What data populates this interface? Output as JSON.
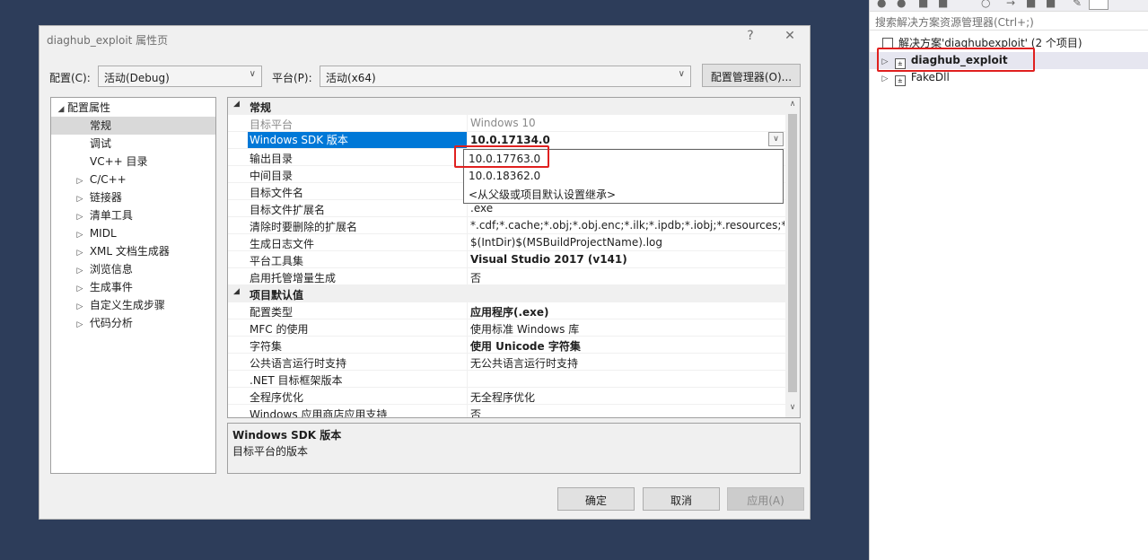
{
  "dialog": {
    "title": "diaghub_exploit 属性页",
    "help": "?",
    "close": "✕",
    "config_label": "配置(C):",
    "config_value": "活动(Debug)",
    "platform_label": "平台(P):",
    "platform_value": "活动(x64)",
    "config_manager": "配置管理器(O)...",
    "ok": "确定",
    "cancel": "取消",
    "apply": "应用(A)"
  },
  "tree": {
    "root": "配置属性",
    "items": [
      {
        "label": "常规",
        "expandable": false,
        "selected": true
      },
      {
        "label": "调试",
        "expandable": false
      },
      {
        "label": "VC++ 目录",
        "expandable": false
      },
      {
        "label": "C/C++",
        "expandable": true
      },
      {
        "label": "链接器",
        "expandable": true
      },
      {
        "label": "清单工具",
        "expandable": true
      },
      {
        "label": "MIDL",
        "expandable": true
      },
      {
        "label": "XML 文档生成器",
        "expandable": true
      },
      {
        "label": "浏览信息",
        "expandable": true
      },
      {
        "label": "生成事件",
        "expandable": true
      },
      {
        "label": "自定义生成步骤",
        "expandable": true
      },
      {
        "label": "代码分析",
        "expandable": true
      }
    ]
  },
  "grid": {
    "cat_general": "常规",
    "cat_defaults": "项目默认值",
    "general_rows": [
      {
        "name": "目标平台",
        "value": "Windows 10",
        "style": "gray"
      },
      {
        "name": "Windows SDK 版本",
        "value": "10.0.17134.0",
        "style": "selected"
      },
      {
        "name": "输出目录",
        "value": ""
      },
      {
        "name": "中间目录",
        "value": ""
      },
      {
        "name": "目标文件名",
        "value": ""
      },
      {
        "name": "目标文件扩展名",
        "value": ".exe"
      },
      {
        "name": "清除时要删除的扩展名",
        "value": "*.cdf;*.cache;*.obj;*.obj.enc;*.ilk;*.ipdb;*.iobj;*.resources;*.tlb;*.tli;*.tlh;*.tmp"
      },
      {
        "name": "生成日志文件",
        "value": "$(IntDir)$(MSBuildProjectName).log"
      },
      {
        "name": "平台工具集",
        "value": "Visual Studio 2017 (v141)",
        "style": "bold"
      },
      {
        "name": "启用托管增量生成",
        "value": "否"
      }
    ],
    "default_rows": [
      {
        "name": "配置类型",
        "value": "应用程序(.exe)",
        "style": "bold"
      },
      {
        "name": "MFC 的使用",
        "value": "使用标准 Windows 库"
      },
      {
        "name": "字符集",
        "value": "使用 Unicode 字符集",
        "style": "bold"
      },
      {
        "name": "公共语言运行时支持",
        "value": "无公共语言运行时支持"
      },
      {
        "name": ".NET 目标框架版本",
        "value": ""
      },
      {
        "name": "全程序优化",
        "value": "无全程序优化"
      },
      {
        "name": "Windows 应用商店应用支持",
        "value": "否"
      }
    ]
  },
  "dropdown": {
    "options": [
      "10.0.17763.0",
      "10.0.18362.0",
      "<从父级或项目默认设置继承>"
    ]
  },
  "description": {
    "title": "Windows SDK 版本",
    "text": "目标平台的版本"
  },
  "solution_explorer": {
    "search_placeholder": "搜索解决方案资源管理器(Ctrl+;)",
    "solution_label": "解决方案'diaghubexploit' (2 个项目)",
    "projects": [
      {
        "label": "diaghub_exploit",
        "selected": true
      },
      {
        "label": "FakeDll",
        "selected": false
      }
    ]
  },
  "colors": {
    "highlight_box": "#e0201f",
    "selection": "#0078d7",
    "desktop": "#2d3d5a"
  }
}
